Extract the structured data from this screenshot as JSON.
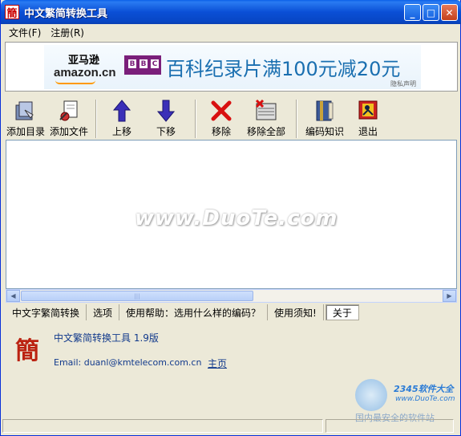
{
  "window": {
    "title": "中文繁简转换工具",
    "app_char": "簡"
  },
  "menu": [
    {
      "label": "文件(F)"
    },
    {
      "label": "注册(R)"
    }
  ],
  "ad": {
    "amazon_zh": "亚马逊",
    "amazon_en": "amazon.cn",
    "bbc": [
      "B",
      "B",
      "C"
    ],
    "text": "百科纪录片满100元减20元",
    "note": "隐私声明"
  },
  "toolbar": [
    {
      "label": "添加目录"
    },
    {
      "label": "添加文件"
    },
    {
      "label": "上移"
    },
    {
      "label": "下移"
    },
    {
      "label": "移除"
    },
    {
      "label": "移除全部"
    },
    {
      "label": "编码知识"
    },
    {
      "label": "退出"
    }
  ],
  "watermark": "www.DuoTe.com",
  "tabs": [
    {
      "label": "中文字繁简转换"
    },
    {
      "label": "选项"
    },
    {
      "label": "使用帮助：选用什么样的编码？"
    },
    {
      "label": "使用须知!"
    },
    {
      "label": "关于"
    }
  ],
  "about": {
    "logo_char": "簡",
    "title": "中文繁简转换工具 1.9版",
    "email": "Email: duanl@kmtelecom.com.cn",
    "homepage_link": "主页"
  },
  "corner_watermark": {
    "brand": "2345软件大全",
    "url": "www.DuoTe.com",
    "site": "国内最安全的软件站"
  },
  "colors": {
    "titlebar": "#0a4fd6",
    "accent": "#123a8c",
    "close": "#c3401c"
  }
}
